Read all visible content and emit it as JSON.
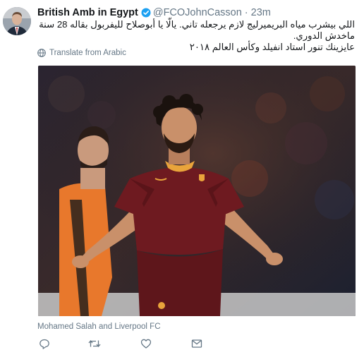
{
  "tweet": {
    "display_name": "British Amb in Egypt",
    "handle": "@FCOJohnCasson",
    "separator": "·",
    "time": "23m",
    "text_line1": "اللي بيشرب مياه البريميرليج لازم يرجعله تاني. يالّا يا أبوصلاح لليفربول بقاله 28 سنة ماخدش الدوري.",
    "text_line2": "عايزينك تنور استاد انفيلد وكأس العالم ٢٠١٨",
    "translate_label": "Translate from Arabic",
    "media_caption": "Mohamed Salah and Liverpool FC"
  },
  "media": {
    "jersey_primary": "#6e1a20",
    "jersey_trim": "#e9a43b",
    "goalkeeper_kit": "#e8782c"
  },
  "actions": [
    {
      "icon": "reply-icon"
    },
    {
      "icon": "retweet-icon"
    },
    {
      "icon": "like-icon"
    },
    {
      "icon": "direct-message-icon"
    }
  ],
  "colors": {
    "text": "#14171a",
    "muted": "#657786",
    "verified": "#1da1f2"
  }
}
